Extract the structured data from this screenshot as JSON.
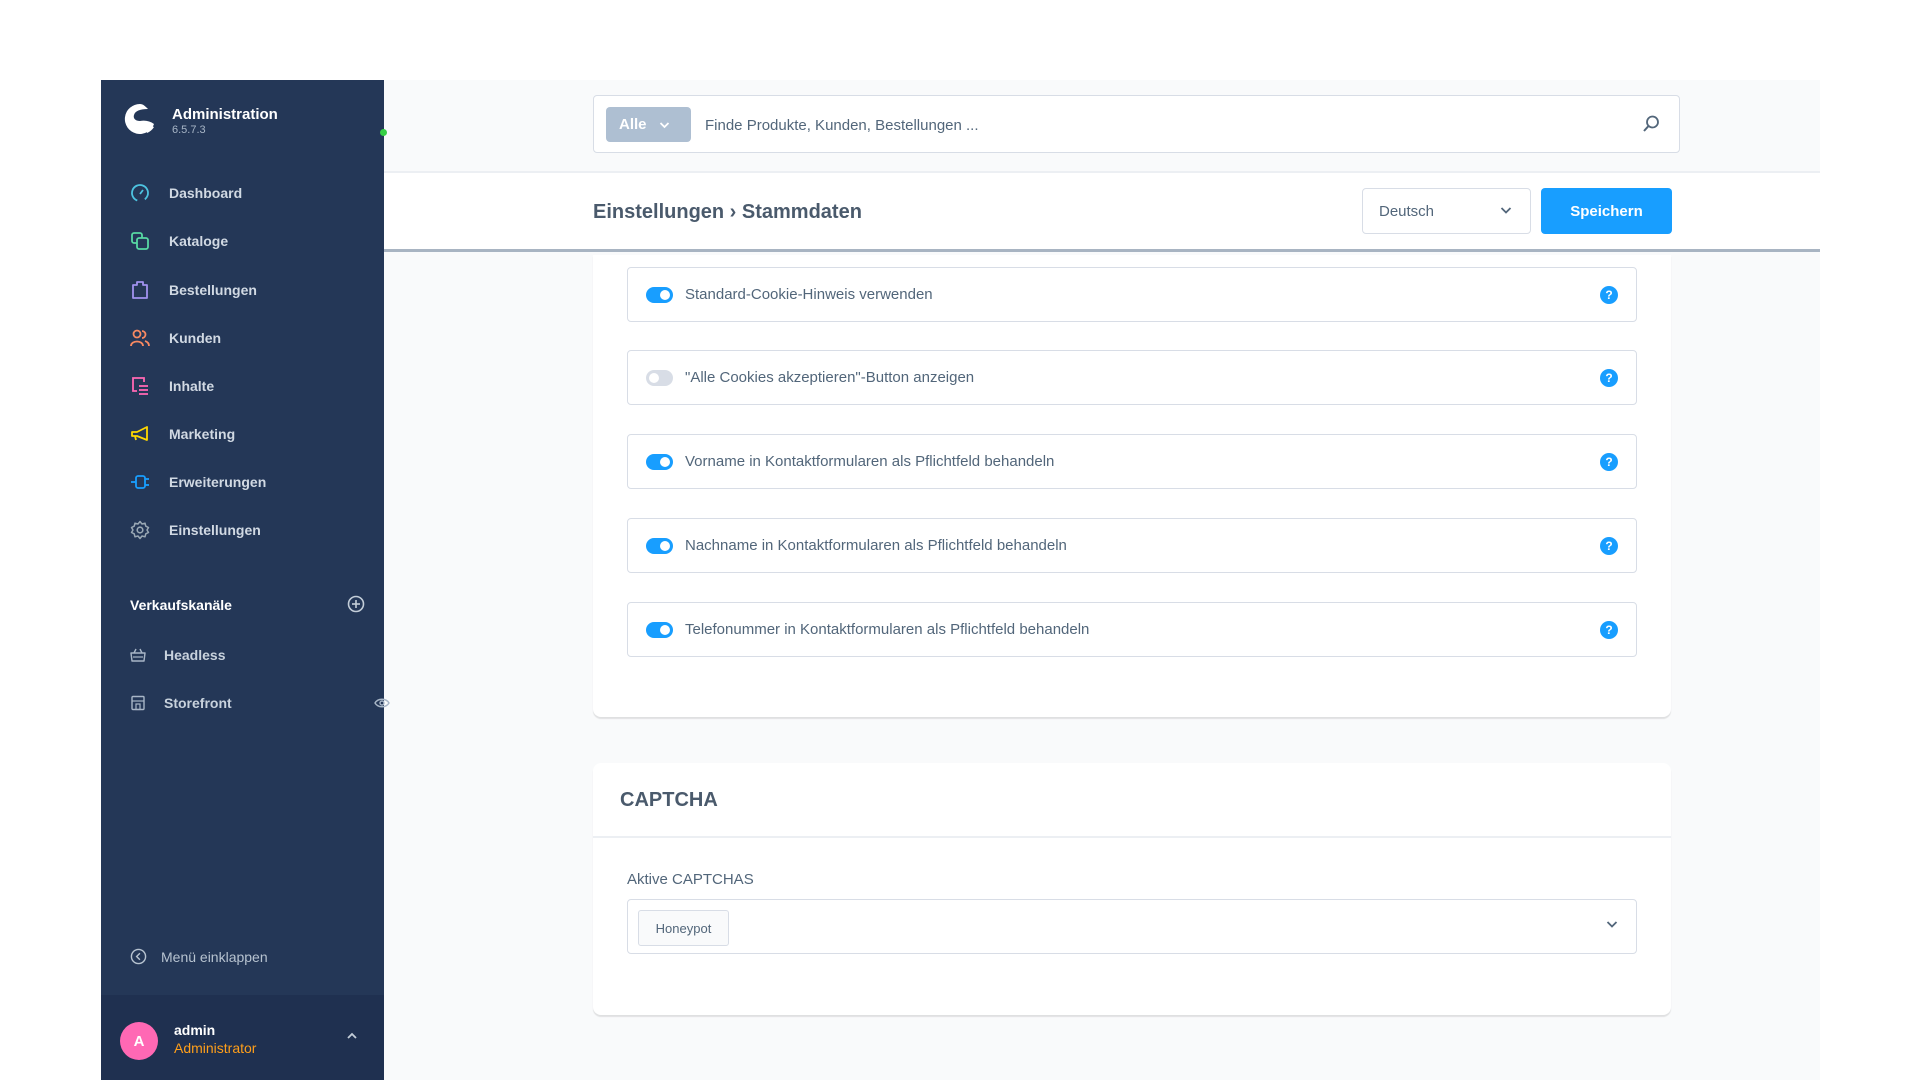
{
  "app": {
    "title": "Administration",
    "version": "6.5.7.3",
    "status_color": "#37d046"
  },
  "sidebar": {
    "items": [
      {
        "label": "Dashboard",
        "icon": "dashboard-icon",
        "color": "#4dc3e0"
      },
      {
        "label": "Kataloge",
        "icon": "catalog-icon",
        "color": "#57d9a3"
      },
      {
        "label": "Bestellungen",
        "icon": "orders-icon",
        "color": "#a092f0"
      },
      {
        "label": "Kunden",
        "icon": "customers-icon",
        "color": "#f88962"
      },
      {
        "label": "Inhalte",
        "icon": "content-icon",
        "color": "#ff68b4"
      },
      {
        "label": "Marketing",
        "icon": "marketing-icon",
        "color": "#ffd700"
      },
      {
        "label": "Erweiterungen",
        "icon": "extensions-icon",
        "color": "#189eff"
      },
      {
        "label": "Einstellungen",
        "icon": "settings-icon",
        "color": "#9aa8b5"
      }
    ],
    "sales_channels": {
      "title": "Verkaufskanäle",
      "items": [
        {
          "label": "Headless",
          "icon": "basket-icon"
        },
        {
          "label": "Storefront",
          "icon": "storefront-icon"
        }
      ]
    },
    "collapse_label": "Menü einklappen",
    "user": {
      "initial": "A",
      "name": "admin",
      "role": "Administrator"
    }
  },
  "search": {
    "type_label": "Alle",
    "placeholder": "Finde Produkte, Kunden, Bestellungen ..."
  },
  "header": {
    "breadcrumb": "Einstellungen › Stammdaten",
    "language": "Deutsch",
    "save_label": "Speichern"
  },
  "settings": {
    "rows": [
      {
        "label": "Standard-Cookie-Hinweis verwenden",
        "enabled": true
      },
      {
        "label": "\"Alle Cookies akzeptieren\"-Button anzeigen",
        "enabled": false
      },
      {
        "label": "Vorname in Kontaktformularen als Pflichtfeld behandeln",
        "enabled": true
      },
      {
        "label": "Nachname in Kontaktformularen als Pflichtfeld behandeln",
        "enabled": true
      },
      {
        "label": "Telefonummer in Kontaktformularen als Pflichtfeld behandeln",
        "enabled": true
      }
    ],
    "help_glyph": "?"
  },
  "captcha": {
    "title": "CAPTCHA",
    "field_label": "Aktive CAPTCHAS",
    "selected": [
      "Honeypot"
    ]
  },
  "colors": {
    "primary": "#189eff",
    "sidebar": "#243757",
    "avatar": "#ff68b4",
    "role": "#ff9f1a"
  }
}
